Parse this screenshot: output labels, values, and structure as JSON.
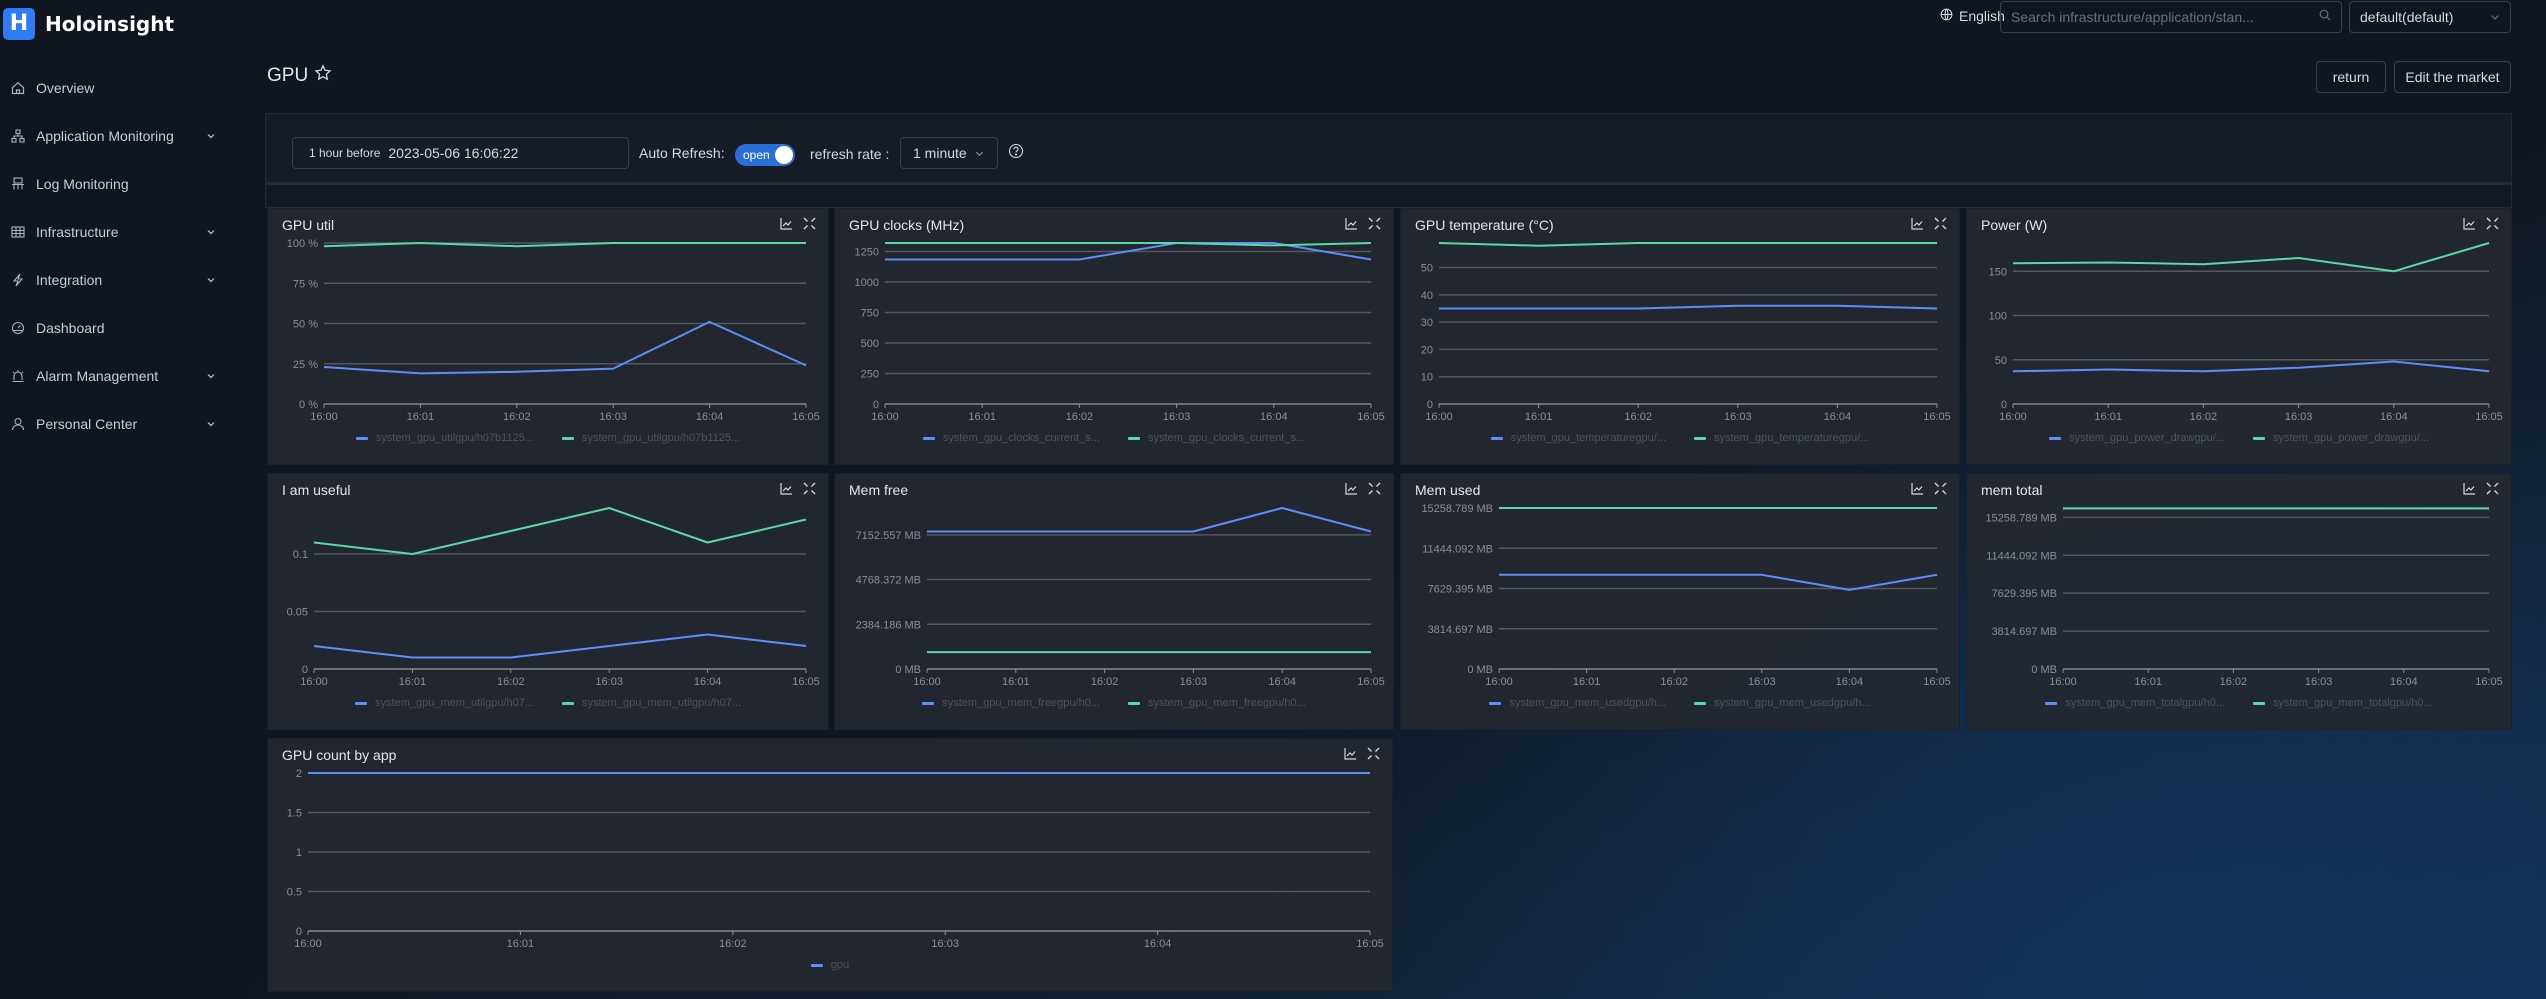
{
  "app": {
    "logo_letter": "H",
    "name": "Holoinsight"
  },
  "sidebar": {
    "items": [
      {
        "label": "Overview",
        "icon": "home-icon",
        "expandable": false
      },
      {
        "label": "Application Monitoring",
        "icon": "sitemap-icon",
        "expandable": true
      },
      {
        "label": "Log Monitoring",
        "icon": "log-icon",
        "expandable": false
      },
      {
        "label": "Infrastructure",
        "icon": "table-icon",
        "expandable": true
      },
      {
        "label": "Integration",
        "icon": "bolt-icon",
        "expandable": true
      },
      {
        "label": "Dashboard",
        "icon": "dashboard-icon",
        "expandable": false
      },
      {
        "label": "Alarm Management",
        "icon": "alarm-icon",
        "expandable": true
      },
      {
        "label": "Personal Center",
        "icon": "user-icon",
        "expandable": true
      }
    ]
  },
  "topbar": {
    "language": "English",
    "search_placeholder": "Search infrastructure/application/stan...",
    "tenant": "default(default)"
  },
  "page": {
    "title": "GPU",
    "return_label": "return",
    "edit_label": "Edit the market"
  },
  "filters": {
    "range_prefix": "1 hour before",
    "range_value": "2023-05-06 16:06:22",
    "auto_refresh_label": "Auto Refresh:",
    "auto_refresh_state": "open",
    "refresh_rate_label": "refresh rate :",
    "refresh_rate_value": "1 minute"
  },
  "colors": {
    "series1": "#5b8ff9",
    "series2": "#5ad8a6",
    "accent": "#2f7bf5"
  },
  "chart_data": [
    {
      "type": "line",
      "title": "GPU util",
      "x": [
        "16:00",
        "16:01",
        "16:02",
        "16:03",
        "16:04",
        "16:05"
      ],
      "yticks": [
        "0 %",
        "25 %",
        "50 %",
        "75 %",
        "100 %"
      ],
      "ylim": [
        0,
        100
      ],
      "series": [
        {
          "name": "system_gpu_utilgpu/h07b1125...",
          "values": [
            23,
            19,
            20,
            22,
            51,
            24
          ]
        },
        {
          "name": "system_gpu_utilgpu/h07b1125...",
          "values": [
            98,
            100,
            98,
            100,
            100,
            100
          ]
        }
      ]
    },
    {
      "type": "line",
      "title": "GPU clocks (MHz)",
      "x": [
        "16:00",
        "16:01",
        "16:02",
        "16:03",
        "16:04",
        "16:05"
      ],
      "yticks": [
        "0",
        "250",
        "500",
        "750",
        "1000",
        "1250"
      ],
      "ylim": [
        0,
        1320
      ],
      "series": [
        {
          "name": "system_gpu_clocks_current_s...",
          "values": [
            1185,
            1185,
            1185,
            1320,
            1320,
            1185
          ]
        },
        {
          "name": "system_gpu_clocks_current_s...",
          "values": [
            1320,
            1320,
            1320,
            1320,
            1300,
            1320
          ]
        }
      ]
    },
    {
      "type": "line",
      "title": "GPU temperature (°C)",
      "x": [
        "16:00",
        "16:01",
        "16:02",
        "16:03",
        "16:04",
        "16:05"
      ],
      "yticks": [
        "0",
        "10",
        "20",
        "30",
        "40",
        "50"
      ],
      "ylim": [
        0,
        59
      ],
      "series": [
        {
          "name": "system_gpu_temperaturegpu/...",
          "values": [
            35,
            35,
            35,
            36,
            36,
            35
          ]
        },
        {
          "name": "system_gpu_temperaturegpu/...",
          "values": [
            59,
            58,
            59,
            59,
            59,
            59
          ]
        }
      ]
    },
    {
      "type": "line",
      "title": "Power (W)",
      "x": [
        "16:00",
        "16:01",
        "16:02",
        "16:03",
        "16:04",
        "16:05"
      ],
      "yticks": [
        "0",
        "50",
        "100",
        "150"
      ],
      "ylim": [
        0,
        182
      ],
      "series": [
        {
          "name": "system_gpu_power_drawgpu/...",
          "values": [
            37,
            39,
            37,
            41,
            48,
            37
          ]
        },
        {
          "name": "system_gpu_power_drawgpu/...",
          "values": [
            159,
            160,
            158,
            165,
            150,
            182
          ]
        }
      ]
    },
    {
      "type": "line",
      "title": "I am useful",
      "x": [
        "16:00",
        "16:01",
        "16:02",
        "16:03",
        "16:04",
        "16:05"
      ],
      "yticks": [
        "0",
        "0.05",
        "0.1"
      ],
      "ylim": [
        0,
        0.14
      ],
      "series": [
        {
          "name": "system_gpu_mem_utilgpu/h07...",
          "values": [
            0.02,
            0.01,
            0.01,
            0.02,
            0.03,
            0.02
          ]
        },
        {
          "name": "system_gpu_mem_utilgpu/h07...",
          "values": [
            0.11,
            0.1,
            0.12,
            0.14,
            0.11,
            0.13
          ]
        }
      ]
    },
    {
      "type": "line",
      "title": "Mem free",
      "x": [
        "16:00",
        "16:01",
        "16:02",
        "16:03",
        "16:04",
        "16:05"
      ],
      "yticks": [
        "0 MB",
        "2384.186 MB",
        "4768.372 MB",
        "7152.557 MB"
      ],
      "ylim": [
        0,
        8583
      ],
      "series": [
        {
          "name": "system_gpu_mem_freegpu/h0...",
          "values": [
            7330,
            7330,
            7330,
            7330,
            8583,
            7330
          ]
        },
        {
          "name": "system_gpu_mem_freegpu/h0...",
          "values": [
            900,
            900,
            900,
            900,
            900,
            900
          ]
        }
      ]
    },
    {
      "type": "line",
      "title": "Mem used",
      "x": [
        "16:00",
        "16:01",
        "16:02",
        "16:03",
        "16:04",
        "16:05"
      ],
      "yticks": [
        "0 MB",
        "3814.697 MB",
        "7629.395 MB",
        "11444.092 MB",
        "15258.789 MB"
      ],
      "ylim": [
        0,
        15258.789
      ],
      "series": [
        {
          "name": "system_gpu_mem_usedgpu/h...",
          "values": [
            8930,
            8930,
            8930,
            8930,
            7500,
            8930
          ]
        },
        {
          "name": "system_gpu_mem_usedgpu/h...",
          "values": [
            15258.789,
            15258.789,
            15258.789,
            15258.789,
            15258.789,
            15258.789
          ]
        }
      ]
    },
    {
      "type": "line",
      "title": "mem total",
      "x": [
        "16:00",
        "16:01",
        "16:02",
        "16:03",
        "16:04",
        "16:05"
      ],
      "yticks": [
        "0 MB",
        "3814.697 MB",
        "7629.395 MB",
        "11444.092 MB",
        "15258.789 MB"
      ],
      "ylim": [
        0,
        16200
      ],
      "series": [
        {
          "name": "system_gpu_mem_totalgpu/h0...",
          "values": [
            16160,
            16160,
            16160,
            16160,
            16160,
            16160
          ]
        },
        {
          "name": "system_gpu_mem_totalgpu/h0...",
          "values": [
            16160,
            16160,
            16160,
            16160,
            16160,
            16160
          ]
        }
      ]
    },
    {
      "type": "line",
      "title": "GPU count by app",
      "x": [
        "16:00",
        "16:01",
        "16:02",
        "16:03",
        "16:04",
        "16:05"
      ],
      "yticks": [
        "0",
        "0.5",
        "1",
        "1.5",
        "2"
      ],
      "ylim": [
        0,
        2
      ],
      "series": [
        {
          "name": "gpu",
          "values": [
            2,
            2,
            2,
            2,
            2,
            2
          ]
        }
      ]
    }
  ]
}
